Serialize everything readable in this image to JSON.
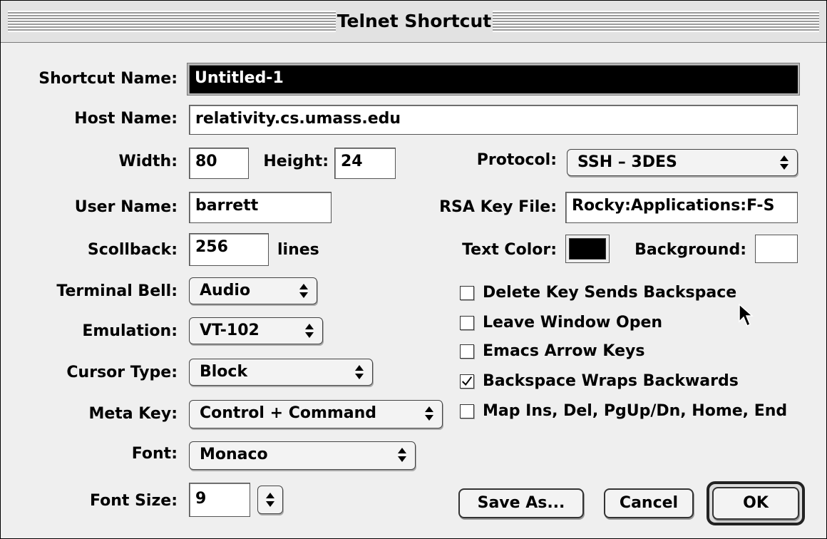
{
  "window": {
    "title": "Telnet Shortcut"
  },
  "labels": {
    "shortcut_name": "Shortcut Name:",
    "host_name": "Host Name:",
    "width": "Width:",
    "height": "Height:",
    "protocol": "Protocol:",
    "user_name": "User Name:",
    "rsa_key_file": "RSA Key File:",
    "scrollback": "Scollback:",
    "lines": "lines",
    "text_color": "Text Color:",
    "background": "Background:",
    "terminal_bell": "Terminal Bell:",
    "emulation": "Emulation:",
    "cursor_type": "Cursor Type:",
    "meta_key": "Meta Key:",
    "font": "Font:",
    "font_size": "Font Size:"
  },
  "fields": {
    "shortcut_name": "Untitled-1",
    "host_name": "relativity.cs.umass.edu",
    "width": "80",
    "height": "24",
    "user_name": "barrett",
    "rsa_key_file": "Rocky:Applications:F-S",
    "scrollback": "256",
    "font_size": "9"
  },
  "popups": {
    "protocol": "SSH – 3DES",
    "terminal_bell": "Audio",
    "emulation": "VT-102",
    "cursor_type": "Block",
    "meta_key": "Control + Command",
    "font": "Monaco"
  },
  "colors": {
    "text_color": "#000000",
    "background": "#ffffff"
  },
  "checkboxes": [
    {
      "label": "Delete Key Sends Backspace",
      "checked": false
    },
    {
      "label": "Leave Window Open",
      "checked": false
    },
    {
      "label": "Emacs Arrow Keys",
      "checked": false
    },
    {
      "label": "Backspace Wraps Backwards",
      "checked": true
    },
    {
      "label": "Map Ins, Del, PgUp/Dn, Home, End",
      "checked": false
    }
  ],
  "buttons": {
    "save_as": "Save As...",
    "cancel": "Cancel",
    "ok": "OK"
  },
  "icons": {
    "popup_arrows": "up-down-arrows-icon",
    "checkmark": "checkmark-icon",
    "cursor": "mouse-pointer-icon"
  }
}
